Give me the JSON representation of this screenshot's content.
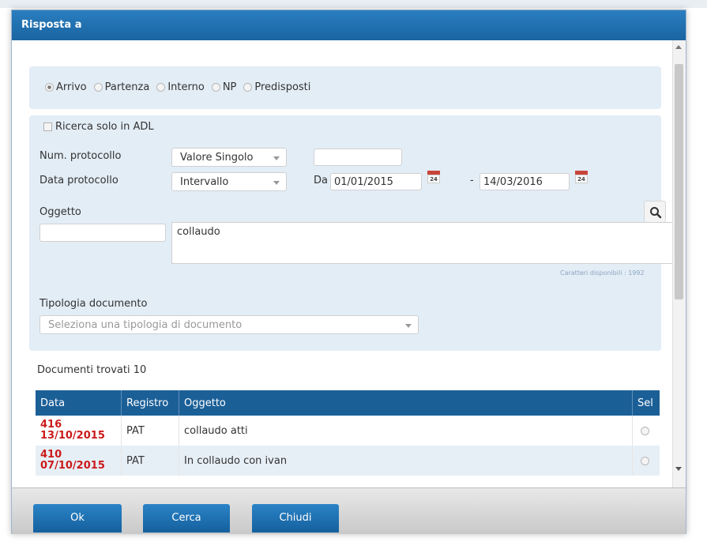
{
  "dialog": {
    "title": "Risposta a"
  },
  "registry_types": {
    "options": [
      "Arrivo",
      "Partenza",
      "Interno",
      "NP",
      "Predisposti"
    ],
    "selected": "Arrivo"
  },
  "filters": {
    "adl_label": "Ricerca solo in ADL",
    "num_protocollo": {
      "label": "Num. protocollo",
      "mode": "Valore Singolo",
      "value": ""
    },
    "data_protocollo": {
      "label": "Data protocollo",
      "mode": "Intervallo",
      "from_label": "Da",
      "from": "01/01/2015",
      "to_label": "-",
      "to": "14/03/2016",
      "calendar_day": "24"
    },
    "oggetto": {
      "label": "Oggetto",
      "code_value": "",
      "text": "collaudo",
      "chars_left": "Caratteri disponibili : 1992"
    },
    "tipologia": {
      "label": "Tipologia documento",
      "placeholder": "Seleziona una tipologia di documento"
    }
  },
  "results": {
    "count_label": "Documenti trovati 10",
    "columns": [
      "Data",
      "Registro",
      "Oggetto",
      "Sel"
    ],
    "rows": [
      {
        "num": "416",
        "date": "13/10/2015",
        "registro": "PAT",
        "oggetto": "collaudo atti"
      },
      {
        "num": "410",
        "date": "07/10/2015",
        "registro": "PAT",
        "oggetto": "In collaudo con ivan"
      }
    ]
  },
  "footer": {
    "ok": "Ok",
    "cerca": "Cerca",
    "chiudi": "Chiudi"
  },
  "colors": {
    "titlebar": "#1b69a8",
    "table_header": "#1b5f97",
    "date_red": "#cc1a1a",
    "panel": "#e3edf6"
  },
  "icons": [
    "calendar-icon",
    "search-icon",
    "dropdown-arrow-icon",
    "radio-icon",
    "checkbox-icon"
  ]
}
